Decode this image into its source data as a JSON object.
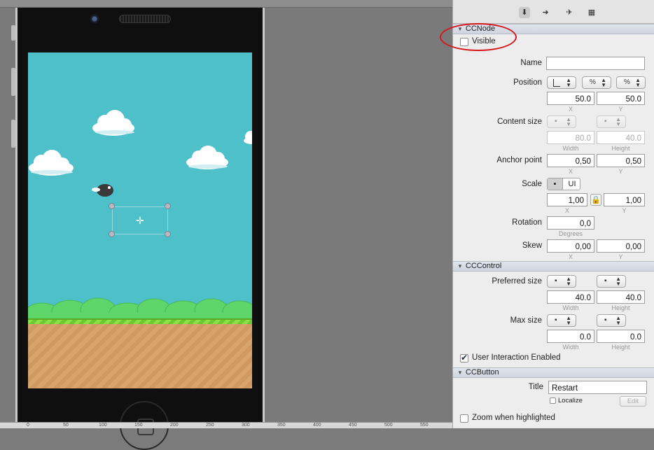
{
  "inspector": {
    "tabs": [
      "properties-icon",
      "code-connections-icon",
      "physics-icon",
      "templates-icon"
    ],
    "ccnode": {
      "header": "CCNode",
      "visible_label": "Visible",
      "visible_checked": false,
      "name_label": "Name",
      "name_value": "",
      "position_label": "Position",
      "position_units": [
        "",
        "%",
        "%"
      ],
      "position_x": "50.0",
      "position_y": "50.0",
      "x_label": "X",
      "y_label": "Y",
      "content_size_label": "Content size",
      "content_width": "80.0",
      "content_height": "40.0",
      "width_label": "Width",
      "height_label": "Height",
      "anchor_label": "Anchor point",
      "anchor_x": "0,50",
      "anchor_y": "0,50",
      "scale_label": "Scale",
      "scale_ui": "UI",
      "scale_x": "1,00",
      "scale_y": "1,00",
      "rotation_label": "Rotation",
      "rotation_value": "0,0",
      "degrees_label": "Degrees",
      "skew_label": "Skew",
      "skew_x": "0,00",
      "skew_y": "0,00"
    },
    "cccontrol": {
      "header": "CCControl",
      "preferred_label": "Preferred size",
      "preferred_width": "40.0",
      "preferred_height": "40.0",
      "max_label": "Max size",
      "max_width": "0.0",
      "max_height": "0.0",
      "user_interaction_label": "User Interaction Enabled",
      "user_interaction_checked": true
    },
    "ccbutton": {
      "header": "CCButton",
      "title_label": "Title",
      "title_value": "Restart",
      "localize_label": "Localize",
      "edit_label": "Edit",
      "zoom_label": "Zoom when highlighted"
    }
  },
  "ruler": {
    "ticks": [
      "0",
      "50",
      "100",
      "150",
      "200",
      "250",
      "300",
      "350",
      "400",
      "450",
      "500",
      "550"
    ]
  },
  "colors": {
    "sky": "#4ec0ca",
    "annotation": "#d6161b"
  }
}
